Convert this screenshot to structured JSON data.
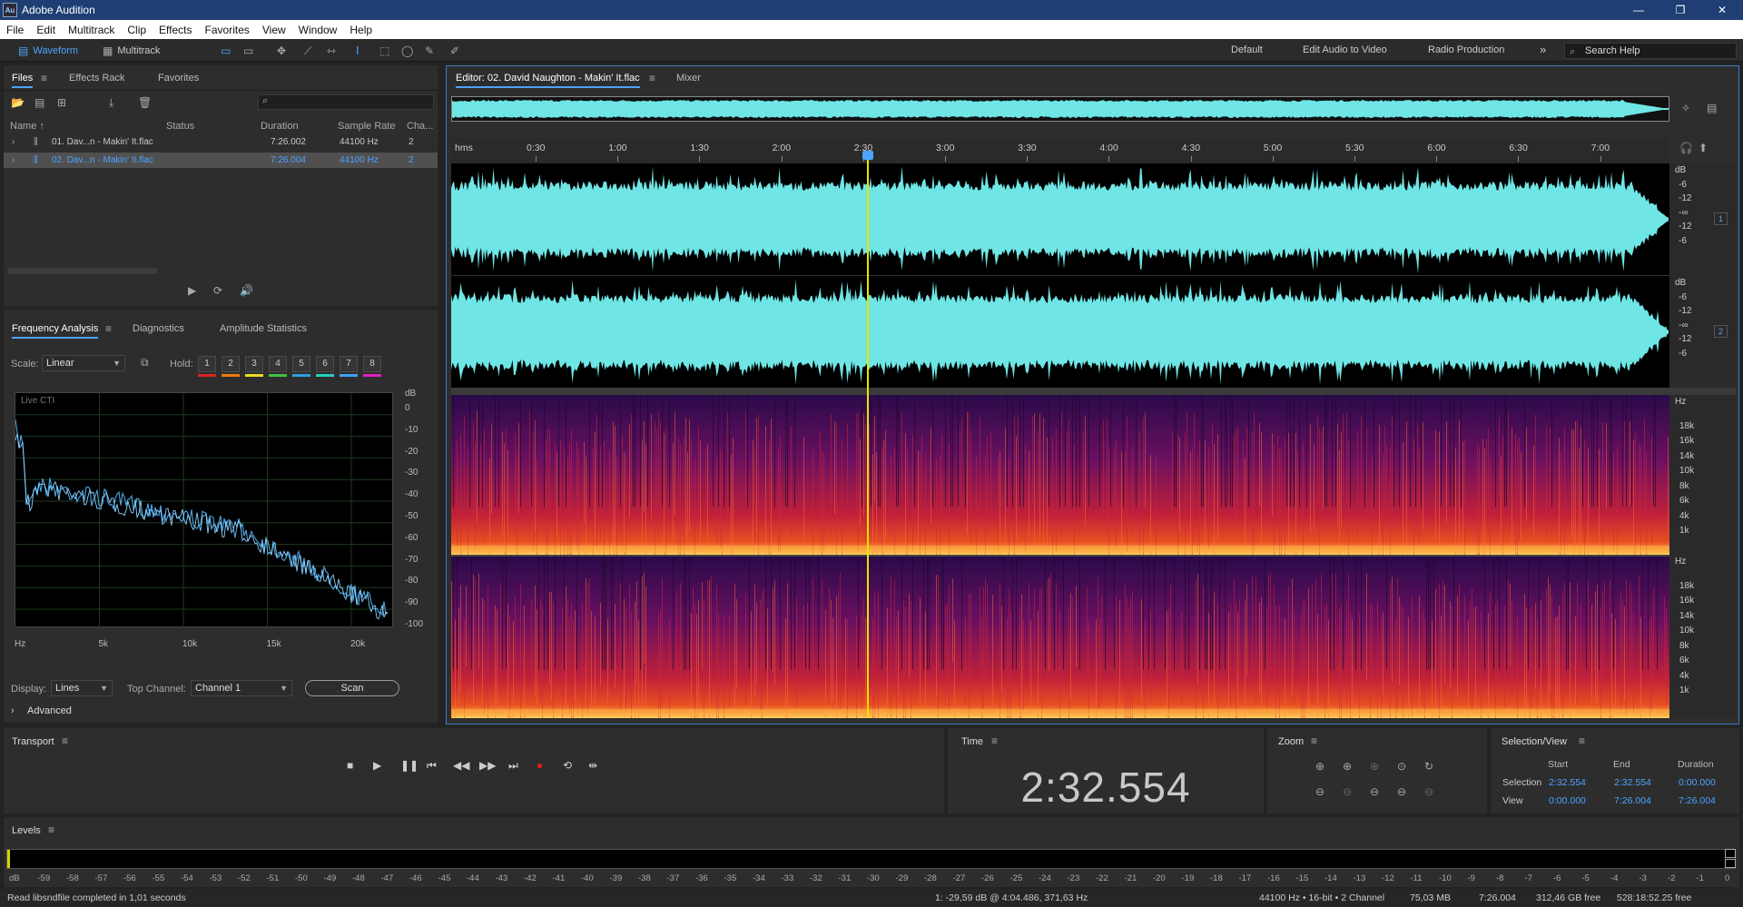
{
  "app": {
    "title": "Adobe Audition",
    "logo": "Au"
  },
  "window_controls": {
    "minimize": "—",
    "maximize": "❐",
    "close": "✕"
  },
  "menu": [
    "File",
    "Edit",
    "Multitrack",
    "Clip",
    "Effects",
    "Favorites",
    "View",
    "Window",
    "Help"
  ],
  "toolbar": {
    "waveform": "Waveform",
    "multitrack": "Multitrack",
    "workspaces": [
      "Default",
      "Edit Audio to Video",
      "Radio Production"
    ],
    "more": "»",
    "search_placeholder": "Search Help"
  },
  "files_panel": {
    "tabs": [
      "Files",
      "Effects Rack",
      "Favorites"
    ],
    "search_icon": "search-icon",
    "columns": [
      "Name ↑",
      "Status",
      "Duration",
      "Sample Rate",
      "Cha..."
    ],
    "rows": [
      {
        "name": "01. Dav...n - Makin' It.flac",
        "duration": "7:26.002",
        "rate": "44100 Hz",
        "ch": "2"
      },
      {
        "name": "02. Dav...n - Makin' It.flac",
        "duration": "7:26.004",
        "rate": "44100 Hz",
        "ch": "2"
      }
    ]
  },
  "freq_panel": {
    "tabs": [
      "Frequency Analysis",
      "Diagnostics",
      "Amplitude Statistics"
    ],
    "scale_label": "Scale:",
    "scale_value": "Linear",
    "hold_label": "Hold:",
    "holds": [
      "1",
      "2",
      "3",
      "4",
      "5",
      "6",
      "7",
      "8"
    ],
    "hold_colors": [
      "#e02020",
      "#f07a10",
      "#e8e020",
      "#40c040",
      "#30a0e0",
      "#20d0c0",
      "#40a0ff",
      "#e020c0"
    ],
    "live": "Live CTI",
    "db_unit": "dB",
    "db_ticks": [
      "0",
      "-10",
      "-20",
      "-30",
      "-40",
      "-50",
      "-60",
      "-70",
      "-80",
      "-90",
      "-100"
    ],
    "hz_ticks": [
      "Hz",
      "5k",
      "10k",
      "15k",
      "20k"
    ],
    "display_label": "Display:",
    "display_value": "Lines",
    "topch_label": "Top Channel:",
    "topch_value": "Channel 1",
    "scan": "Scan",
    "advanced": "Advanced",
    "advanced_chevron": "›"
  },
  "editor": {
    "tab": "Editor: 02. David Naughton - Makin' It.flac",
    "mixer": "Mixer",
    "ruler": [
      "hms",
      "0:30",
      "1:00",
      "1:30",
      "2:00",
      "2:30",
      "3:00",
      "3:30",
      "4:00",
      "4:30",
      "5:00",
      "5:30",
      "6:00",
      "6:30",
      "7:00"
    ],
    "db_labels_ch1": [
      "dB",
      "-6",
      "-12",
      "-∞",
      "-12",
      "-6"
    ],
    "db_labels_ch2": [
      "dB",
      "-6",
      "-12",
      "-∞",
      "-12",
      "-6"
    ],
    "ch1": "1",
    "ch2": "2",
    "hz_labels": [
      "Hz",
      "18k",
      "16k",
      "14k",
      "10k",
      "8k",
      "6k",
      "4k",
      "1k"
    ],
    "wave_color": "#6fe5e5",
    "playhead_position": "2:32.554"
  },
  "transport": {
    "title": "Transport"
  },
  "time": {
    "title": "Time",
    "value": "2:32.554"
  },
  "zoom": {
    "title": "Zoom"
  },
  "selection_view": {
    "title": "Selection/View",
    "cols": [
      "Start",
      "End",
      "Duration"
    ],
    "rows": [
      {
        "label": "Selection",
        "start": "2:32.554",
        "end": "2:32.554",
        "duration": "0:00.000"
      },
      {
        "label": "View",
        "start": "0:00.000",
        "end": "7:26.004",
        "duration": "7:26.004"
      }
    ]
  },
  "levels": {
    "title": "Levels",
    "ticks": [
      "dB",
      "-59",
      "-58",
      "-57",
      "-56",
      "-55",
      "-54",
      "-53",
      "-52",
      "-51",
      "-50",
      "-49",
      "-48",
      "-47",
      "-46",
      "-45",
      "-44",
      "-43",
      "-42",
      "-41",
      "-40",
      "-39",
      "-38",
      "-37",
      "-36",
      "-35",
      "-34",
      "-33",
      "-32",
      "-31",
      "-30",
      "-29",
      "-28",
      "-27",
      "-26",
      "-25",
      "-24",
      "-23",
      "-22",
      "-21",
      "-20",
      "-19",
      "-18",
      "-17",
      "-16",
      "-15",
      "-14",
      "-13",
      "-12",
      "-11",
      "-10",
      "-9",
      "-8",
      "-7",
      "-6",
      "-5",
      "-4",
      "-3",
      "-2",
      "-1",
      "0"
    ]
  },
  "status": {
    "left": "Read libsndfile completed in 1,01 seconds",
    "cursor": "1: -29,59 dB @ 4:04.486, 371,63 Hz",
    "format": "44100 Hz • 16-bit • 2 Channel",
    "size": "75,03 MB",
    "duration": "7:26.004",
    "free": "312,46 GB free",
    "free_time": "528:18:52.25 free"
  }
}
